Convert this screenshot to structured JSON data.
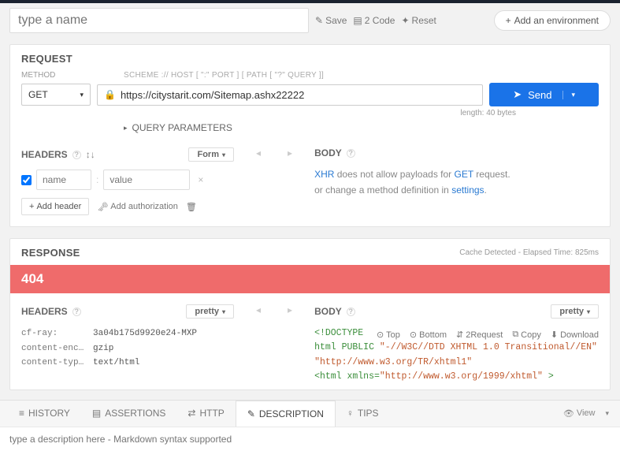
{
  "topbar": {
    "name_placeholder": "type a name",
    "save_label": "Save",
    "code_label": "2 Code",
    "reset_label": "Reset",
    "add_env_label": "Add an environment"
  },
  "request": {
    "title": "REQUEST",
    "method_label": "METHOD",
    "method_value": "GET",
    "scheme_hint": "SCHEME :// HOST [ \":\" PORT ] [ PATH [ \"?\" QUERY ]]",
    "url_value": "https://citystarit.com/Sitemap.ashx22222",
    "send_label": "Send",
    "length_info": "length: 40 bytes",
    "query_params_label": "QUERY PARAMETERS",
    "headers": {
      "title": "HEADERS",
      "form_toggle": "Form",
      "name_placeholder": "name",
      "value_placeholder": "value",
      "add_header": "Add header",
      "add_auth": "Add authorization"
    },
    "body": {
      "title": "BODY",
      "xhr": "XHR",
      "msg1_mid": " does not allow payloads for ",
      "get": "GET",
      "msg1_end": " request.",
      "msg2_pre": "or change a method definition in ",
      "settings": "settings",
      "msg2_end": "."
    }
  },
  "response": {
    "title": "RESPONSE",
    "meta": "Cache Detected - Elapsed Time: 825ms",
    "status": "404",
    "headers_title": "HEADERS",
    "body_title": "BODY",
    "pretty_label": "pretty",
    "headers": [
      {
        "k": "cf-ray:",
        "v": "3a04b175d9920e24-MXP"
      },
      {
        "k": "content-enc…",
        "v": "gzip"
      },
      {
        "k": "content-typ…",
        "v": "text/html"
      }
    ],
    "actions": {
      "top": "Top",
      "bottom": "Bottom",
      "req": "2Request",
      "copy": "Copy",
      "download": "Download"
    },
    "code_lines": [
      {
        "pre": "<!DOCTYPE html PUBLIC ",
        "str": "\"-//W3C//DTD XHTML 1.0 Transitional//EN\""
      },
      {
        "str": "\"http://www.w3.org/TR/xhtml1\""
      },
      {
        "pre": "<html xmlns=",
        "str": "\"http://www.w3.org/1999/xhtml\"",
        "post": " >"
      }
    ]
  },
  "tabs": {
    "history": "HISTORY",
    "assertions": "ASSERTIONS",
    "http": "HTTP",
    "description": "DESCRIPTION",
    "tips": "TIPS",
    "view": "View"
  },
  "description": {
    "placeholder": "type a description here - Markdown syntax supported"
  }
}
